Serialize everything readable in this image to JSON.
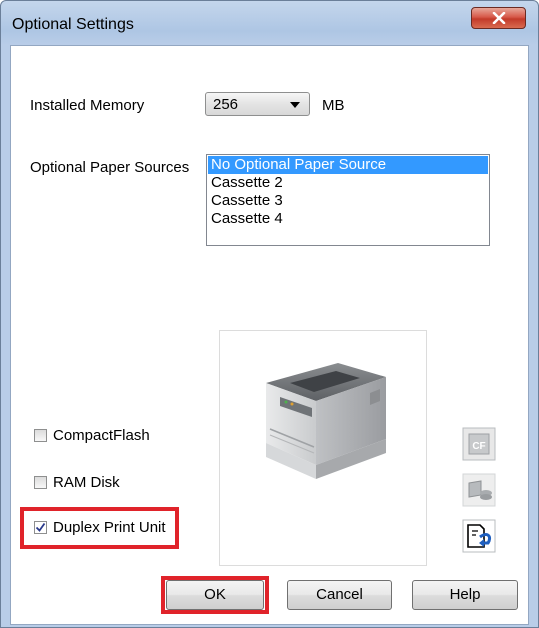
{
  "window": {
    "title": "Optional Settings",
    "close_icon": "close-icon"
  },
  "memory": {
    "label": "Installed Memory",
    "value": "256",
    "unit": "MB"
  },
  "paper_sources": {
    "label": "Optional Paper Sources",
    "items": [
      "No Optional Paper Source",
      "Cassette 2",
      "Cassette 3",
      "Cassette 4"
    ],
    "selected_index": 0
  },
  "options": {
    "compactflash": {
      "label": "CompactFlash",
      "checked": false
    },
    "ram_disk": {
      "label": "RAM Disk",
      "checked": false
    },
    "duplex": {
      "label": "Duplex Print Unit",
      "checked": true
    }
  },
  "side_icons": [
    "compactflash-icon",
    "ram-disk-icon",
    "duplex-unit-icon"
  ],
  "image": {
    "icon": "printer-icon"
  },
  "buttons": {
    "ok": "OK",
    "cancel": "Cancel",
    "help": "Help"
  },
  "colors": {
    "highlight": "#e0232a",
    "selection": "#3399ff",
    "close_button": "#c33a2a"
  }
}
